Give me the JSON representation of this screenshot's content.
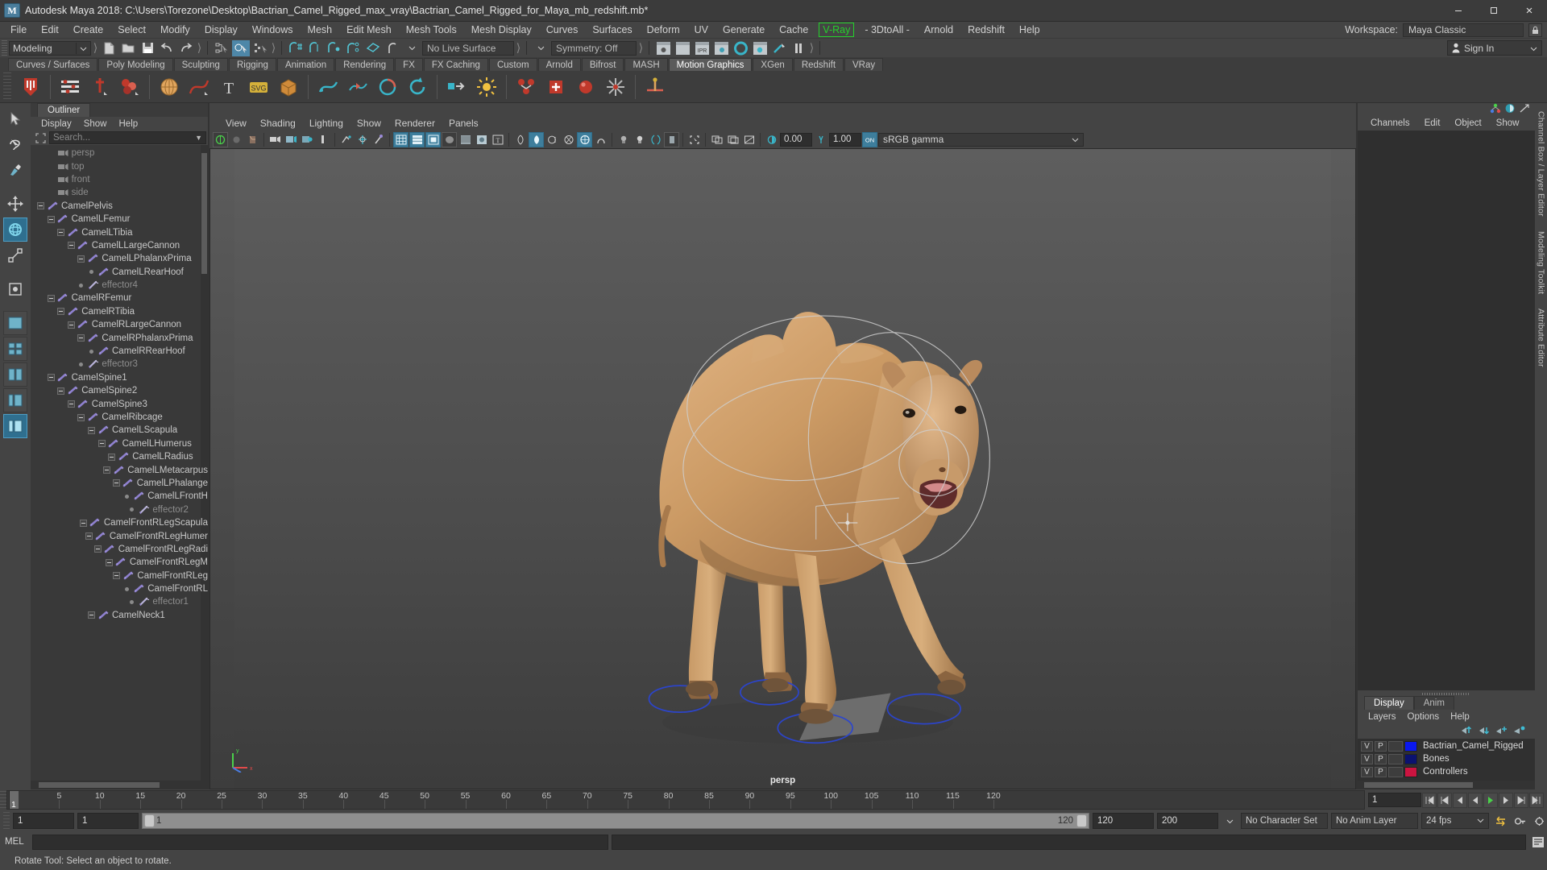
{
  "window": {
    "title": "Autodesk Maya 2018: C:\\Users\\Torezone\\Desktop\\Bactrian_Camel_Rigged_max_vray\\Bactrian_Camel_Rigged_for_Maya_mb_redshift.mb*",
    "logo": "M",
    "minimize": "minimize-icon",
    "maximize": "maximize-icon",
    "close": "close-icon"
  },
  "menubar": {
    "items": [
      "File",
      "Edit",
      "Create",
      "Select",
      "Modify",
      "Display",
      "Windows",
      "Mesh",
      "Edit Mesh",
      "Mesh Tools",
      "Mesh Display",
      "Curves",
      "Surfaces",
      "Deform",
      "UV",
      "Generate",
      "Cache"
    ],
    "highlighted": "V-Ray",
    "items_after": [
      "- 3DtoAll -",
      "Arnold",
      "Redshift",
      "Help"
    ],
    "workspace_label": "Workspace:",
    "workspace_value": "Maya Classic"
  },
  "statusbar": {
    "mode": "Modeling",
    "live_surface": "No Live Surface",
    "symmetry": "Symmetry: Off",
    "signin": "Sign In"
  },
  "shelf": {
    "tabs": [
      "Curves / Surfaces",
      "Poly Modeling",
      "Sculpting",
      "Rigging",
      "Animation",
      "Rendering",
      "FX",
      "FX Caching",
      "Custom",
      "Arnold",
      "Bifrost",
      "MASH",
      "Motion Graphics",
      "XGen",
      "Redshift",
      "VRay"
    ],
    "active_tab": "Motion Graphics"
  },
  "outliner": {
    "tab": "Outliner",
    "menu": [
      "Display",
      "Show",
      "Help"
    ],
    "search_placeholder": "Search...",
    "rows": [
      {
        "label": "persp",
        "depth": 1,
        "icon": "camera-icon",
        "node": "none",
        "dim": true
      },
      {
        "label": "top",
        "depth": 1,
        "icon": "camera-icon",
        "node": "none",
        "dim": true
      },
      {
        "label": "front",
        "depth": 1,
        "icon": "camera-icon",
        "node": "none",
        "dim": true
      },
      {
        "label": "side",
        "depth": 1,
        "icon": "camera-icon",
        "node": "none",
        "dim": true
      },
      {
        "label": "CamelPelvis",
        "depth": 0,
        "icon": "joint-icon",
        "node": "expanded",
        "dim": false
      },
      {
        "label": "CamelLFemur",
        "depth": 1,
        "icon": "joint-icon",
        "node": "expanded",
        "dim": false
      },
      {
        "label": "CamelLTibia",
        "depth": 2,
        "icon": "joint-icon",
        "node": "expanded",
        "dim": false
      },
      {
        "label": "CamelLLargeCannon",
        "depth": 3,
        "icon": "joint-icon",
        "node": "expanded",
        "dim": false
      },
      {
        "label": "CamelLPhalanxPrima",
        "depth": 4,
        "icon": "joint-icon",
        "node": "expanded",
        "dim": false
      },
      {
        "label": "CamelLRearHoof",
        "depth": 5,
        "icon": "joint-icon",
        "node": "leaf",
        "dim": false
      },
      {
        "label": "effector4",
        "depth": 4,
        "icon": "effector-icon",
        "node": "leaf",
        "dim": true
      },
      {
        "label": "CamelRFemur",
        "depth": 1,
        "icon": "joint-icon",
        "node": "expanded",
        "dim": false
      },
      {
        "label": "CamelRTibia",
        "depth": 2,
        "icon": "joint-icon",
        "node": "expanded",
        "dim": false
      },
      {
        "label": "CamelRLargeCannon",
        "depth": 3,
        "icon": "joint-icon",
        "node": "expanded",
        "dim": false
      },
      {
        "label": "CamelRPhalanxPrima",
        "depth": 4,
        "icon": "joint-icon",
        "node": "expanded",
        "dim": false
      },
      {
        "label": "CamelRRearHoof",
        "depth": 5,
        "icon": "joint-icon",
        "node": "leaf",
        "dim": false
      },
      {
        "label": "effector3",
        "depth": 4,
        "icon": "effector-icon",
        "node": "leaf",
        "dim": true
      },
      {
        "label": "CamelSpine1",
        "depth": 1,
        "icon": "joint-icon",
        "node": "expanded",
        "dim": false
      },
      {
        "label": "CamelSpine2",
        "depth": 2,
        "icon": "joint-icon",
        "node": "expanded",
        "dim": false
      },
      {
        "label": "CamelSpine3",
        "depth": 3,
        "icon": "joint-icon",
        "node": "expanded",
        "dim": false
      },
      {
        "label": "CamelRibcage",
        "depth": 4,
        "icon": "joint-icon",
        "node": "expanded",
        "dim": false
      },
      {
        "label": "CamelLScapula",
        "depth": 5,
        "icon": "joint-icon",
        "node": "expanded",
        "dim": false
      },
      {
        "label": "CamelLHumerus",
        "depth": 6,
        "icon": "joint-icon",
        "node": "expanded",
        "dim": false
      },
      {
        "label": "CamelLRadius",
        "depth": 7,
        "icon": "joint-icon",
        "node": "expanded",
        "dim": false
      },
      {
        "label": "CamelLMetacarpus",
        "depth": 8,
        "icon": "joint-icon",
        "node": "expanded",
        "dim": false
      },
      {
        "label": "CamelLPhalange",
        "depth": 9,
        "icon": "joint-icon",
        "node": "expanded",
        "dim": false
      },
      {
        "label": "CamelLFrontH",
        "depth": 10,
        "icon": "joint-icon",
        "node": "leaf",
        "dim": false
      },
      {
        "label": "effector2",
        "depth": 9,
        "icon": "effector-icon",
        "node": "leaf",
        "dim": true
      },
      {
        "label": "CamelFrontRLegScapula",
        "depth": 5,
        "icon": "joint-icon",
        "node": "expanded",
        "dim": false
      },
      {
        "label": "CamelFrontRLegHumer",
        "depth": 6,
        "icon": "joint-icon",
        "node": "expanded",
        "dim": false
      },
      {
        "label": "CamelFrontRLegRadi",
        "depth": 7,
        "icon": "joint-icon",
        "node": "expanded",
        "dim": false
      },
      {
        "label": "CamelFrontRLegM",
        "depth": 8,
        "icon": "joint-icon",
        "node": "expanded",
        "dim": false
      },
      {
        "label": "CamelFrontRLeg",
        "depth": 9,
        "icon": "joint-icon",
        "node": "expanded",
        "dim": false
      },
      {
        "label": "CamelFrontRL",
        "depth": 10,
        "icon": "joint-icon",
        "node": "leaf",
        "dim": false
      },
      {
        "label": "effector1",
        "depth": 9,
        "icon": "effector-icon",
        "node": "leaf",
        "dim": true
      },
      {
        "label": "CamelNeck1",
        "depth": 5,
        "icon": "joint-icon",
        "node": "expanded",
        "dim": false
      }
    ]
  },
  "viewport": {
    "menu": [
      "View",
      "Shading",
      "Lighting",
      "Show",
      "Renderer",
      "Panels"
    ],
    "exposure": "0.00",
    "gamma_value": "1.00",
    "color_space": "sRGB gamma",
    "camera_label": "persp"
  },
  "channelbox": {
    "menu": [
      "Channels",
      "Edit",
      "Object",
      "Show"
    ],
    "vertical_tabs": [
      "Channel Box / Layer Editor",
      "Modeling Toolkit",
      "Attribute Editor"
    ]
  },
  "layers": {
    "tabs": [
      "Display",
      "Anim"
    ],
    "active_tab": "Display",
    "menu": [
      "Layers",
      "Options",
      "Help"
    ],
    "rows": [
      {
        "v": "V",
        "p": "P",
        "color": "#0a18f0",
        "name": "Bactrian_Camel_Rigged"
      },
      {
        "v": "V",
        "p": "P",
        "color": "#0b1270",
        "name": "Bones"
      },
      {
        "v": "V",
        "p": "P",
        "color": "#cc1440",
        "name": "Controllers"
      }
    ]
  },
  "timeline": {
    "current_frame": "1",
    "ticks": [
      5,
      10,
      15,
      20,
      25,
      30,
      35,
      40,
      45,
      50,
      55,
      60,
      65,
      70,
      75,
      80,
      85,
      90,
      95,
      100,
      105,
      110,
      115,
      120
    ],
    "frame_field": "1"
  },
  "range": {
    "start": "1",
    "anim_start": "1",
    "slider_start": "1",
    "slider_end": "120",
    "range_end": "120",
    "anim_end": "200",
    "character_set": "No Character Set",
    "anim_layer": "No Anim Layer",
    "fps": "24 fps"
  },
  "command": {
    "label": "MEL",
    "input": "",
    "output": ""
  },
  "helpline": {
    "text": "Rotate Tool: Select an object to rotate."
  },
  "colors": {
    "accent": "#4e87a8",
    "highlight_green": "#24d12b",
    "panel_bg": "#444444",
    "tree_bg": "#393939"
  }
}
